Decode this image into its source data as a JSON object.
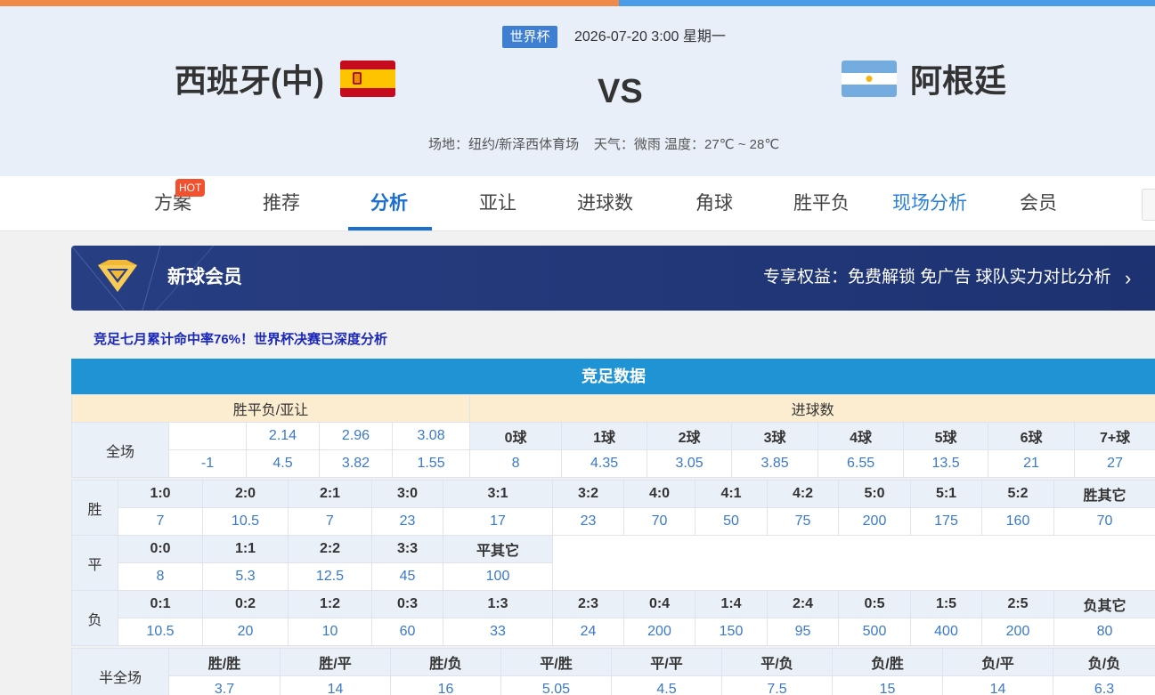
{
  "match": {
    "competition": "世界杯",
    "datetime": "2026-07-20 3:00 星期一",
    "home": "西班牙(中)",
    "away": "阿根廷",
    "vs": "VS",
    "venue": "场地：纽约/新泽西体育场",
    "weather": "天气：微雨 温度：27℃ ~ 28℃"
  },
  "nav": {
    "hot_badge": "HOT",
    "items": [
      "方案",
      "推荐",
      "分析",
      "亚让",
      "进球数",
      "角球",
      "胜平负",
      "现场分析",
      "会员"
    ]
  },
  "vip": {
    "title": "新球会员",
    "benefits": "专享权益：免费解锁 免广告 球队实力对比分析",
    "chevron": "›"
  },
  "promo": "竞足七月累计命中率76%！世界杯决赛已深度分析",
  "jingzu": {
    "title": "竞足数据",
    "spf_header": "胜平负/亚让",
    "goals_header": "进球数",
    "full_label": "全场",
    "spf_row1": [
      "",
      "2.14",
      "2.96",
      "3.08"
    ],
    "spf_row2": [
      "-1",
      "4.5",
      "3.82",
      "1.55"
    ],
    "goals_labels": [
      "0球",
      "1球",
      "2球",
      "3球",
      "4球",
      "5球",
      "6球",
      "7+球"
    ],
    "goals_values": [
      "8",
      "4.35",
      "3.05",
      "3.85",
      "6.55",
      "13.5",
      "21",
      "27"
    ],
    "win": {
      "label": "胜",
      "scores": [
        "1:0",
        "2:0",
        "2:1",
        "3:0",
        "3:1",
        "3:2",
        "4:0",
        "4:1",
        "4:2",
        "5:0",
        "5:1",
        "5:2",
        "胜其它"
      ],
      "odds": [
        "7",
        "10.5",
        "7",
        "23",
        "17",
        "23",
        "70",
        "50",
        "75",
        "200",
        "175",
        "160",
        "70"
      ]
    },
    "draw": {
      "label": "平",
      "scores": [
        "0:0",
        "1:1",
        "2:2",
        "3:3",
        "平其它"
      ],
      "odds": [
        "8",
        "5.3",
        "12.5",
        "45",
        "100"
      ]
    },
    "lose": {
      "label": "负",
      "scores": [
        "0:1",
        "0:2",
        "1:2",
        "0:3",
        "1:3",
        "2:3",
        "0:4",
        "1:4",
        "2:4",
        "0:5",
        "1:5",
        "2:5",
        "负其它"
      ],
      "odds": [
        "10.5",
        "20",
        "10",
        "60",
        "33",
        "24",
        "200",
        "150",
        "95",
        "500",
        "400",
        "200",
        "80"
      ]
    },
    "halffull": {
      "label": "半全场",
      "items": [
        "胜/胜",
        "胜/平",
        "胜/负",
        "平/胜",
        "平/平",
        "平/负",
        "负/胜",
        "负/平",
        "负/负"
      ],
      "odds": [
        "3.7",
        "14",
        "16",
        "5.05",
        "4.5",
        "7.5",
        "15",
        "14",
        "6.3"
      ]
    }
  }
}
